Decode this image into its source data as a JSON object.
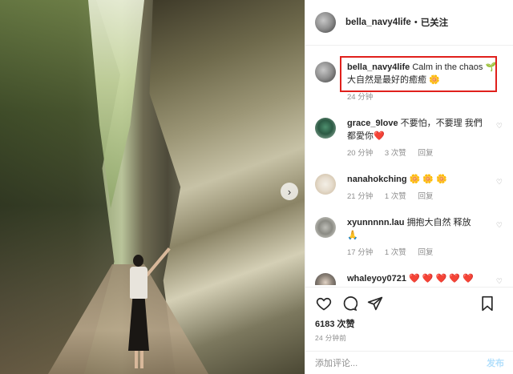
{
  "post": {
    "username": "bella_navy4life",
    "follow_label": "已关注",
    "header_dot": "•",
    "caption": {
      "username": "bella_navy4life",
      "text_en": "Calm in the chaos",
      "emoji_sprout": "🌱",
      "text_cn": "大自然是最好的癒癒",
      "emoji_sun": "🌼",
      "time": "24 分钟"
    },
    "comments": [
      {
        "username": "grace_9love",
        "text": "不要怕，不要理 我們都愛你",
        "emoji": "❤️",
        "time": "20 分钟",
        "likes": "3 次赞",
        "reply": "回复"
      },
      {
        "username": "nanahokching",
        "text": "",
        "emoji": "🌼 🌼 🌼",
        "time": "21 分钟",
        "likes": "1 次赞",
        "reply": "回复"
      },
      {
        "username": "xyunnnnn.lau",
        "text": "拥抱大自然 释放",
        "emoji": "🙏",
        "time": "17 分钟",
        "likes": "1 次赞",
        "reply": "回复"
      },
      {
        "username": "whaleyoy0721",
        "text": "",
        "emoji": "❤️ ❤️ ❤️ ❤️ ❤️",
        "time": "",
        "likes": "",
        "reply": ""
      }
    ],
    "likes_count": "6183 次赞",
    "posted_time": "24 分钟前",
    "add_comment_placeholder": "添加评论...",
    "post_label": "发布",
    "icons": [
      "heart-icon",
      "comment-icon",
      "share-icon",
      "save-icon",
      "chevron-right-icon"
    ],
    "accent_color": "#e0201c"
  }
}
